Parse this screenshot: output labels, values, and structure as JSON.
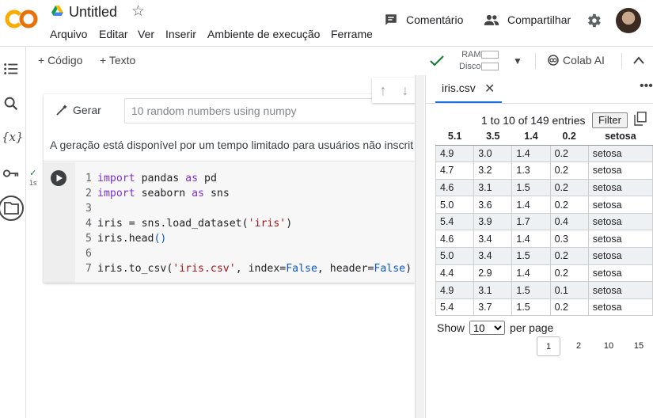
{
  "header": {
    "logo_text": "CO",
    "title": "Untitled",
    "comment_label": "Comentário",
    "share_label": "Compartilhar"
  },
  "menu": [
    "Arquivo",
    "Editar",
    "Ver",
    "Inserir",
    "Ambiente de execução",
    "Ferrame"
  ],
  "toolbar": {
    "code_label": "+ Código",
    "text_label": "+ Texto",
    "ram_label": "RAM",
    "disk_label": "Disco",
    "colab_ai_label": "Colab AI"
  },
  "cell": {
    "generate_label": "Gerar",
    "prompt_placeholder": "10 random numbers using numpy",
    "notice": "A geração está disponível por um tempo limitado para usuários não inscrit",
    "exec_time": "1s",
    "code_lines": [
      "import pandas as pd",
      "import seaborn as sns",
      "",
      "iris = sns.load_dataset('iris')",
      "iris.head()",
      "",
      "iris.to_csv('iris.csv', index=False, header=False)"
    ]
  },
  "file_panel": {
    "tab_label": "iris.csv",
    "entries_text": "1 to 10 of 149 entries",
    "filter_label": "Filter",
    "columns": [
      "5.1",
      "3.5",
      "1.4",
      "0.2",
      "setosa"
    ],
    "rows": [
      [
        "4.9",
        "3.0",
        "1.4",
        "0.2",
        "setosa"
      ],
      [
        "4.7",
        "3.2",
        "1.3",
        "0.2",
        "setosa"
      ],
      [
        "4.6",
        "3.1",
        "1.5",
        "0.2",
        "setosa"
      ],
      [
        "5.0",
        "3.6",
        "1.4",
        "0.2",
        "setosa"
      ],
      [
        "5.4",
        "3.9",
        "1.7",
        "0.4",
        "setosa"
      ],
      [
        "4.6",
        "3.4",
        "1.4",
        "0.3",
        "setosa"
      ],
      [
        "5.0",
        "3.4",
        "1.5",
        "0.2",
        "setosa"
      ],
      [
        "4.4",
        "2.9",
        "1.4",
        "0.2",
        "setosa"
      ],
      [
        "4.9",
        "3.1",
        "1.5",
        "0.1",
        "setosa"
      ],
      [
        "5.4",
        "3.7",
        "1.5",
        "0.2",
        "setosa"
      ]
    ],
    "show_label": "Show",
    "page_size": "10",
    "per_page_label": "per page",
    "pages": [
      "1",
      "2",
      "10",
      "15"
    ]
  },
  "colors": {
    "colab_orange": "#F9AB00",
    "accent_blue": "#1a73e8",
    "check_green": "#188038"
  }
}
